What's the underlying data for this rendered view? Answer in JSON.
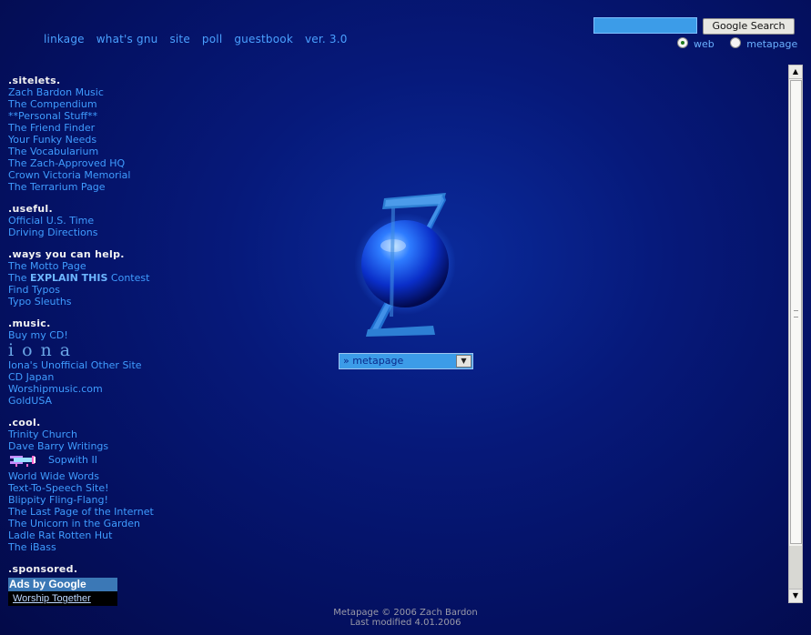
{
  "topnav": [
    "linkage",
    "what's gnu",
    "site",
    "poll",
    "guestbook",
    "ver. 3.0"
  ],
  "search": {
    "button_label": "Google Search",
    "input_value": "",
    "options": [
      "web",
      "metapage"
    ],
    "selected": "web"
  },
  "sidebar": {
    "sitelets": {
      "title": ".sitelets.",
      "items": [
        "Zach Bardon Music",
        "The Compendium",
        "**Personal Stuff**",
        "The Friend Finder",
        "Your Funky Needs",
        "The Vocabularium",
        "The Zach-Approved HQ",
        "Crown Victoria Memorial",
        "The Terrarium Page"
      ]
    },
    "useful": {
      "title": ".useful.",
      "items": [
        "Official U.S. Time",
        "Driving Directions"
      ]
    },
    "help": {
      "title": ".ways you can help.",
      "items": [
        "The Motto Page",
        "Find Typos",
        "Typo Sleuths"
      ],
      "contest_prefix": "The ",
      "contest_bold": "EXPLAIN THIS",
      "contest_suffix": " Contest"
    },
    "music": {
      "title": ".music.",
      "buy": "Buy my CD!",
      "logo_text": "iona",
      "items": [
        "Iona's Unofficial Other Site",
        "CD Japan",
        "Worshipmusic.com",
        "GoldUSA"
      ]
    },
    "cool": {
      "title": ".cool.",
      "items_a": [
        "Trinity Church",
        "Dave Barry Writings"
      ],
      "sopwith": "Sopwith II",
      "items_b": [
        "World Wide Words",
        "Text-To-Speech Site!",
        "Blippity Fling-Flang!",
        "The Last Page of the Internet",
        "The Unicorn in the Garden",
        "Ladle Rat Rotten Hut",
        "The iBass"
      ]
    },
    "sponsored": {
      "title": ".sponsored.",
      "ads_title": "Ads by Google",
      "ad_link": "Worship Together"
    }
  },
  "dropdown": {
    "value": "» metapage"
  },
  "footer": {
    "line1": "Metapage © 2006 Zach Bardon",
    "line2": "Last modified 4.01.2006"
  },
  "colors": {
    "link": "#3f9cff",
    "heading": "#f2f2f2",
    "accent": "#3c9ce8"
  }
}
